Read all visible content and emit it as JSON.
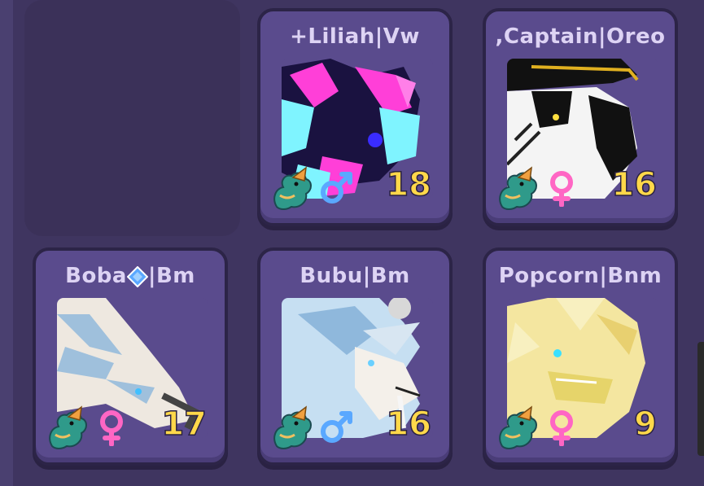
{
  "pets": [
    {
      "name": "+Liliah|Vw",
      "level": "18",
      "gender": "male",
      "species_icon": "dragon-icon",
      "portrait": "neon-pink-cyan-creature"
    },
    {
      "name": ",Captain|Oreo",
      "level": "16",
      "gender": "female",
      "species_icon": "dragon-icon",
      "portrait": "black-white-pirate-hat-creature"
    },
    {
      "name_prefix": "Boba",
      "name_suffix": "|Bm",
      "name_gem_icon": "blue-gem-icon",
      "level": "17",
      "gender": "female",
      "species_icon": "dragon-icon",
      "portrait": "pale-blue-winged-creature"
    },
    {
      "name": "Bubu|Bm",
      "level": "16",
      "gender": "male",
      "species_icon": "dragon-icon",
      "portrait": "light-blue-horned-creature"
    },
    {
      "name": "Popcorn|Bnm",
      "level": "9",
      "gender": "female",
      "species_icon": "dragon-icon",
      "portrait": "golden-crystal-creature"
    }
  ],
  "colors": {
    "background": "#3f3560",
    "card": "#5a4b8d",
    "card_border": "#2c2447",
    "name_text": "#ddd3f4",
    "level_text": "#ffd84a",
    "male": "#5aa8ff",
    "female": "#ff66c4"
  }
}
